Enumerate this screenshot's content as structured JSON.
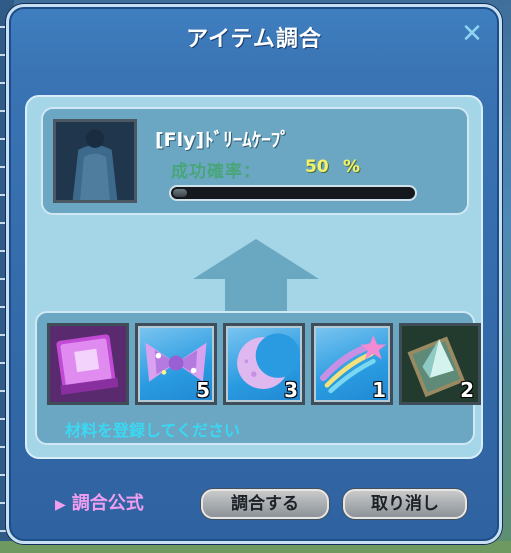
{
  "window": {
    "title": "アイテム調合",
    "close_label": "✕"
  },
  "result": {
    "item_name": "[Fly]ﾄﾞﾘｰﾑｹｰﾌﾟ",
    "success_rate_label": "成功確率：",
    "success_rate_value": "50",
    "success_rate_unit": "%",
    "progress_fraction": 0.06
  },
  "materials": {
    "slots": [
      {
        "icon": "purple-book-icon",
        "count": ""
      },
      {
        "icon": "ribbon-bow-icon",
        "count": "5"
      },
      {
        "icon": "crescent-moon-icon",
        "count": "3"
      },
      {
        "icon": "shooting-star-icon",
        "count": "1"
      },
      {
        "icon": "crystal-card-icon",
        "count": "2"
      }
    ],
    "hint": "材料を登録してください"
  },
  "footer": {
    "formula_label": "調合公式",
    "combine_button": "調合する",
    "cancel_button": "取り消し"
  },
  "colors": {
    "window_blue": "#3a74b4",
    "panel_light": "#a5d6e8",
    "rate_value": "#f4f26a",
    "hint_cyan": "#3ad8f2",
    "formula_pink": "#f09ef0"
  }
}
